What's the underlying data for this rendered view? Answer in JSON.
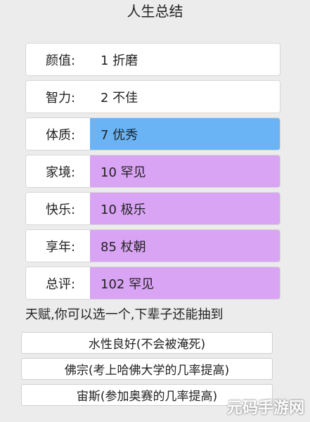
{
  "title": "人生总结",
  "stats": [
    {
      "label": "颜值:",
      "value": "1 折磨",
      "color": "#ffffff"
    },
    {
      "label": "智力:",
      "value": "2 不佳",
      "color": "#ffffff"
    },
    {
      "label": "体质:",
      "value": "7 优秀",
      "color": "#6ab4f5"
    },
    {
      "label": "家境:",
      "value": "10 罕见",
      "color": "#d9a4f3"
    },
    {
      "label": "快乐:",
      "value": "10 极乐",
      "color": "#d9a4f3"
    },
    {
      "label": "享年:",
      "value": "85 杖朝",
      "color": "#d9a4f3"
    },
    {
      "label": "总评:",
      "value": "102 罕见",
      "color": "#d9a4f3"
    }
  ],
  "talent_prompt": "天赋,你可以选一个,下辈子还能抽到",
  "talents": [
    {
      "label": "水性良好(不会被淹死)"
    },
    {
      "label": "佛宗(考上哈佛大学的几率提高)"
    },
    {
      "label": "宙斯(参加奥赛的几率提高)"
    }
  ],
  "watermark": "元码手游网"
}
